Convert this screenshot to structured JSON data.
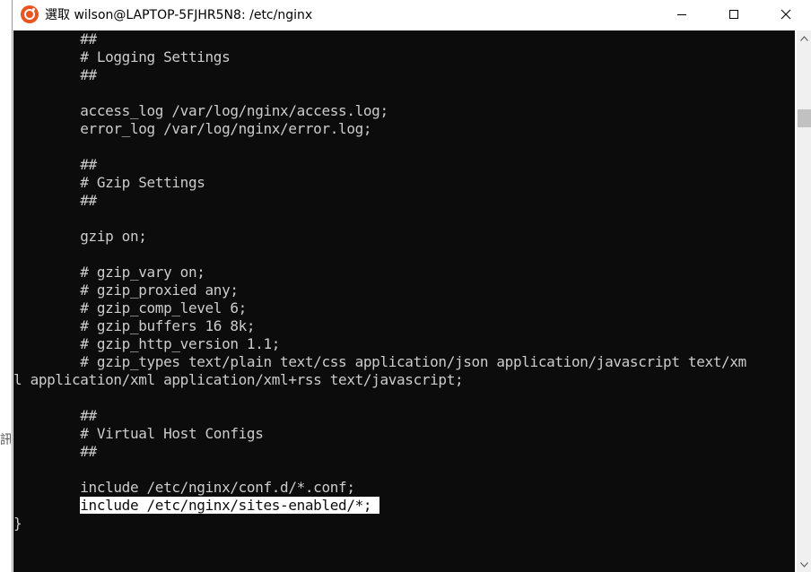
{
  "window": {
    "title": "選取 wilson@LAPTOP-5FJHR5N8: /etc/nginx",
    "app_icon": "ubuntu-icon",
    "controls": [
      "minimize-icon",
      "maximize-icon",
      "close-icon"
    ]
  },
  "side_glyph": "訊",
  "terminal": {
    "lines": [
      "        ##",
      "        # Logging Settings",
      "        ##",
      "",
      "        access_log /var/log/nginx/access.log;",
      "        error_log /var/log/nginx/error.log;",
      "",
      "        ##",
      "        # Gzip Settings",
      "        ##",
      "",
      "        gzip on;",
      "",
      "        # gzip_vary on;",
      "        # gzip_proxied any;",
      "        # gzip_comp_level 6;",
      "        # gzip_buffers 16 8k;",
      "        # gzip_http_version 1.1;",
      "        # gzip_types text/plain text/css application/json application/javascript text/xm",
      "l application/xml application/xml+rss text/javascript;",
      "",
      "        ##",
      "        # Virtual Host Configs",
      "        ##",
      "",
      "        include /etc/nginx/conf.d/*.conf;",
      "        include /etc/nginx/sites-enabled/*;",
      "}"
    ],
    "selected_line_index": 26,
    "selected_prefix": "        ",
    "selected_text": "include /etc/nginx/sites-enabled/*; ",
    "colors": {
      "background": "#0c0c0c",
      "foreground": "#cccccc",
      "selection": "#ffffff"
    }
  },
  "scrollbar": {
    "icons": [
      "chevron-up-icon",
      "chevron-down-icon"
    ]
  }
}
